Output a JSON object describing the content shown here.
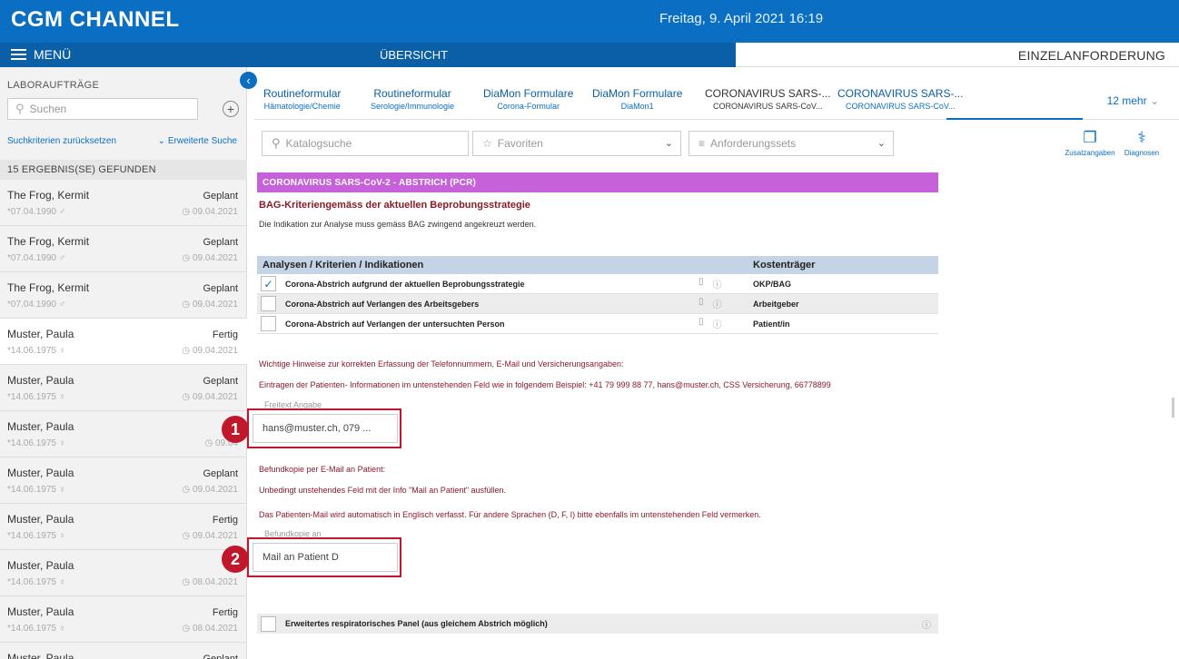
{
  "header": {
    "brand": "CGM CHANNEL",
    "datetime": "Freitag, 9. April 2021 16:19"
  },
  "menubar": {
    "menu_label": "MENÜ",
    "overview": "ÜBERSICHT",
    "single_request": "EINZELANFORDERUNG"
  },
  "sidebar": {
    "title": "LABORAUFTRÄGE",
    "search_placeholder": "Suchen",
    "reset_label": "Suchkriterien zurücksetzen",
    "extended_label": "Erweiterte Suche",
    "results_label": "15 ERGEBNIS(SE) GEFUNDEN",
    "patients": [
      {
        "name": "The Frog, Kermit",
        "status": "Geplant",
        "dob": "*07.04.1990 ♂",
        "date": "09.04.2021"
      },
      {
        "name": "The Frog, Kermit",
        "status": "Geplant",
        "dob": "*07.04.1990 ♂",
        "date": "09.04.2021"
      },
      {
        "name": "The Frog, Kermit",
        "status": "Geplant",
        "dob": "*07.04.1990 ♂",
        "date": "09.04.2021"
      },
      {
        "name": "Muster, Paula",
        "status": "Fertig",
        "dob": "*14.06.1975 ♀",
        "date": "09.04.2021"
      },
      {
        "name": "Muster, Paula",
        "status": "Geplant",
        "dob": "*14.06.1975 ♀",
        "date": "09.04.2021"
      },
      {
        "name": "Muster, Paula",
        "status": "",
        "dob": "*14.06.1975 ♀",
        "date": "09.04"
      },
      {
        "name": "Muster, Paula",
        "status": "Geplant",
        "dob": "*14.06.1975 ♀",
        "date": "09.04.2021"
      },
      {
        "name": "Muster, Paula",
        "status": "Fertig",
        "dob": "*14.06.1975 ♀",
        "date": "09.04.2021"
      },
      {
        "name": "Muster, Paula",
        "status": "",
        "dob": "*14.06.1975 ♀",
        "date": "08.04.2021"
      },
      {
        "name": "Muster, Paula",
        "status": "Fertig",
        "dob": "*14.06.1975 ♀",
        "date": "08.04.2021"
      },
      {
        "name": "Muster, Paula",
        "status": "Geplant",
        "dob": "",
        "date": ""
      }
    ]
  },
  "tabs": [
    {
      "title": "Routineformular",
      "subtitle": "Hämatologie/Chemie"
    },
    {
      "title": "Routineformular",
      "subtitle": "Serologie/Immunologie"
    },
    {
      "title": "DiaMon Formulare",
      "subtitle": "Corona-Formular"
    },
    {
      "title": "DiaMon Formulare",
      "subtitle": "DiaMon1"
    },
    {
      "title": "CORONAVIRUS SARS-...",
      "subtitle": "CORONAVIRUS SARS-CoV..."
    },
    {
      "title": "CORONAVIRUS SARS-...",
      "subtitle": "CORONAVIRUS SARS-CoV..."
    }
  ],
  "more_tabs": "12 mehr",
  "toolbar": {
    "catalog_placeholder": "Katalogsuche",
    "favorites": "Favoriten",
    "request_sets": "Anforderungssets",
    "additional": "Zusatzangaben",
    "diagnoses": "Diagnosen"
  },
  "form": {
    "banner": "CORONAVIRUS SARS-CoV-2 - ABSTRICH (PCR)",
    "criteria_title": "BAG-Kriteriengemäss der aktuellen Beprobungsstrategie",
    "criteria_text": "Die Indikation zur Analyse muss gemäss BAG zwingend angekreuzt werden.",
    "col_analyses": "Analysen / Kriterien / Indikationen",
    "col_payer": "Kostenträger",
    "rows": [
      {
        "label": "Corona-Abstrich aufgrund der aktuellen Beprobungsstrategie",
        "payer": "OKP/BAG",
        "check": "✓"
      },
      {
        "label": "Corona-Abstrich auf Verlangen des Arbeitsgebers",
        "payer": "Arbeitgeber",
        "check": ""
      },
      {
        "label": "Corona-Abstrich auf Verlangen der untersuchten Person",
        "payer": "Patient/in",
        "check": ""
      }
    ],
    "notes_title": "Wichtige Hinweise zur korrekten Erfassung der Telefonnummern, E-Mail und Versicherungsangaben:",
    "notes_text": "Eintragen der Patienten- Informationen im untenstehenden Feld wie in folgendem Beispiel: +41 79 999 88 77, hans@muster.ch, CSS Versicherung, 66778899",
    "freetext_label": "Freitext Angabe",
    "freetext_value": "hans@muster.ch, 079 ...",
    "befund_title": "Befundkopie per E-Mail an Patient:",
    "befund_text1": "Unbedingt unstehendes Feld mit der Info \"Mail an Patient\" ausfüllen.",
    "befund_text2": "Das Patienten-Mail wird automatisch in Englisch verfasst. Für andere Sprachen (D, F, I) bitte ebenfalls im untenstehenden Feld vermerken.",
    "befund_label": "Befundkopie an",
    "befund_value": "Mail an Patient D",
    "panel_label": "Erweitertes respiratorisches Panel (aus gleichem Abstrich möglich)"
  },
  "badges": [
    "1",
    "2"
  ],
  "colors": {
    "header_blue": "#0a6fc2",
    "menubar_blue": "#0a5fa6",
    "banner_purple": "#c661d9",
    "annotation_red": "#c0172a",
    "table_header": "#c4d3e6"
  }
}
